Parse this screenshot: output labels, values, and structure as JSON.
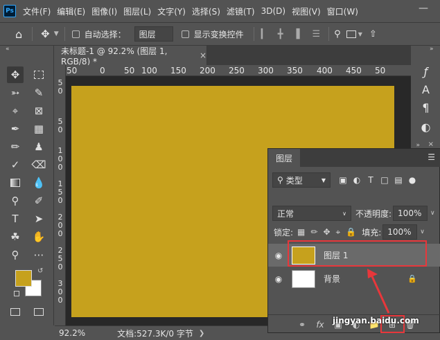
{
  "app": {
    "logo": "Ps",
    "menu": [
      "文件(F)",
      "编辑(E)",
      "图像(I)",
      "图层(L)",
      "文字(Y)",
      "选择(S)",
      "滤镜(T)",
      "3D(D)",
      "视图(V)",
      "窗口(W)"
    ]
  },
  "options_bar": {
    "auto_select_label": "自动选择：",
    "auto_select_value": "图层",
    "show_transform_label": "显示变换控件"
  },
  "document": {
    "tab_title": "未标题-1 @ 92.2% (图层 1, RGB/8) *",
    "close_glyph": "×",
    "ruler_h": [
      "50",
      "0",
      "50",
      "100",
      "150",
      "200",
      "250",
      "300",
      "350",
      "400",
      "450",
      "50"
    ],
    "ruler_v": [
      "5",
      "0",
      "5",
      "0",
      "1",
      "0",
      "0",
      "1",
      "5",
      "0",
      "2",
      "0",
      "0",
      "2",
      "5",
      "0",
      "3",
      "0",
      "0"
    ],
    "canvas_color": "#c6a11d"
  },
  "status": {
    "zoom": "92.2%",
    "doc_size": "文档:527.3K/0 字节"
  },
  "layers_panel": {
    "tab": "图层",
    "filter_kind": "类型",
    "blend_mode": "正常",
    "opacity_label": "不透明度:",
    "opacity_value": "100%",
    "lock_label": "锁定:",
    "fill_label": "填充:",
    "fill_value": "100%",
    "layers": [
      {
        "name": "图层 1",
        "fill": "#c6a11d",
        "selected": true
      },
      {
        "name": "背景",
        "fill": "#ffffff",
        "selected": false
      }
    ],
    "footer_fx": "fx"
  },
  "colors": {
    "foreground": "#c6a11d",
    "background": "#ffffff",
    "highlight": "#e8373b"
  },
  "watermark": "jingyan.baidu.com"
}
